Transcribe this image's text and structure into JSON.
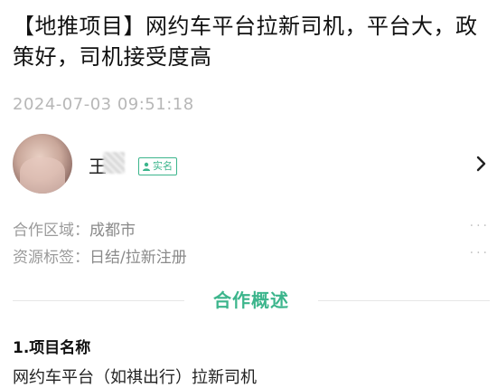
{
  "article": {
    "title": "【地推项目】网约车平台拉新司机，平台大，政策好，司机接受度高",
    "datetime": "2024-07-03 09:51:18"
  },
  "author": {
    "name": "王",
    "verified_label": "实名",
    "icons": {
      "avatar": "user-photo",
      "verified": "person-icon",
      "more": "chevron-right-icon"
    }
  },
  "info": [
    {
      "label": "合作区域：",
      "value": "成都市",
      "more": "···"
    },
    {
      "label": "资源标签：",
      "value": "日结/拉新注册",
      "more": "···"
    }
  ],
  "section": {
    "title": "合作概述",
    "subhead": "1.项目名称",
    "project_name": "网约车平台（如祺出行）拉新司机"
  },
  "colors": {
    "accent": "#3cb58c",
    "muted": "#b7b7b7"
  }
}
